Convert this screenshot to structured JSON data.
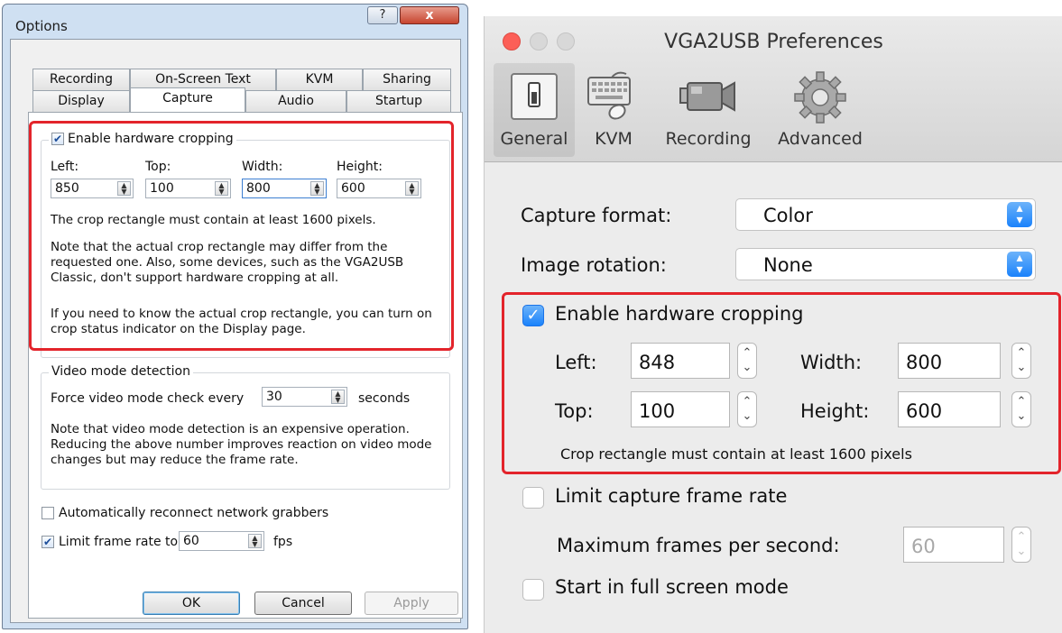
{
  "windows_dialog": {
    "title": "Options",
    "help_glyph": "?",
    "close_glyph": "x",
    "tabs_row1": [
      "Recording",
      "On-Screen Text",
      "KVM",
      "Sharing"
    ],
    "tabs_row2": [
      "Display",
      "Capture",
      "Audio",
      "Startup"
    ],
    "selected_tab": "Capture",
    "cropping": {
      "checkbox_label": "Enable hardware cropping",
      "checked": true,
      "fields": [
        {
          "label": "Left:",
          "value": "850"
        },
        {
          "label": "Top:",
          "value": "100"
        },
        {
          "label": "Width:",
          "value": "800"
        },
        {
          "label": "Height:",
          "value": "600"
        }
      ],
      "note1": "The crop rectangle must contain at least 1600 pixels.",
      "note2": "Note that the actual crop rectangle may differ from the requested one. Also, some devices, such as the VGA2USB Classic, don't support hardware cropping at all.",
      "note3": "If you need to know the actual crop rectangle, you can turn on crop status indicator on the Display page."
    },
    "video_mode": {
      "legend": "Video mode detection",
      "force_label": "Force video mode check every",
      "force_value": "30",
      "force_unit": "seconds",
      "note": "Note that video mode detection is an expensive operation. Reducing the above number improves reaction on video mode changes but may reduce the frame rate."
    },
    "auto_reconnect": {
      "label": "Automatically reconnect network grabbers",
      "checked": false
    },
    "limit_frame_rate": {
      "label": "Limit frame rate to",
      "value": "60",
      "unit": "fps",
      "checked": true
    },
    "buttons": {
      "ok": "OK",
      "cancel": "Cancel",
      "apply": "Apply"
    }
  },
  "mac_prefs": {
    "title": "VGA2USB Preferences",
    "toolbar": [
      {
        "label": "General",
        "icon": "general-switch-icon",
        "selected": true
      },
      {
        "label": "KVM",
        "icon": "keyboard-mouse-icon",
        "selected": false
      },
      {
        "label": "Recording",
        "icon": "video-camera-icon",
        "selected": false
      },
      {
        "label": "Advanced",
        "icon": "gear-icon",
        "selected": false
      }
    ],
    "capture_format": {
      "label": "Capture format:",
      "value": "Color"
    },
    "image_rotation": {
      "label": "Image rotation:",
      "value": "None"
    },
    "cropping": {
      "checkbox_label": "Enable hardware cropping",
      "checked": true,
      "left": {
        "label": "Left:",
        "value": "848"
      },
      "top": {
        "label": "Top:",
        "value": "100"
      },
      "width": {
        "label": "Width:",
        "value": "800"
      },
      "height": {
        "label": "Height:",
        "value": "600"
      },
      "note": "Crop rectangle must contain at least 1600 pixels"
    },
    "limit_rate": {
      "label": "Limit capture frame rate",
      "checked": false
    },
    "max_fps": {
      "label": "Maximum frames per second:",
      "value": "60"
    },
    "fullscreen": {
      "label": "Start in full screen mode",
      "checked": false
    }
  },
  "colors": {
    "highlight_red": "#e3242b",
    "mac_blue": "#1a82fb",
    "win_frame": "#cfe0f2"
  }
}
